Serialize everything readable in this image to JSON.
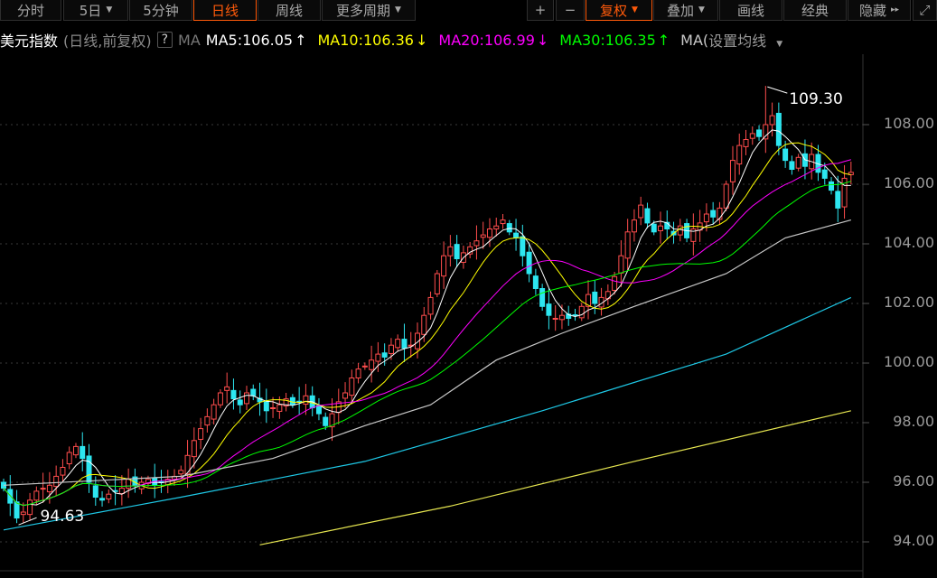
{
  "toolbar": {
    "left": [
      {
        "label": "分时"
      },
      {
        "label": "5日",
        "caret": "▼"
      },
      {
        "label": "5分钟"
      },
      {
        "label": "日线",
        "active": true
      },
      {
        "label": "周线"
      },
      {
        "label": "更多周期",
        "caret": "▼"
      }
    ],
    "right": [
      {
        "label": "+"
      },
      {
        "label": "−"
      },
      {
        "label": "复权",
        "caret": "▼",
        "active": true
      },
      {
        "label": "叠加",
        "caret": "▼"
      },
      {
        "label": "画线"
      },
      {
        "label": "经典"
      },
      {
        "label": "隐藏",
        "caret": "▸▸"
      },
      {
        "label": "⤢"
      }
    ]
  },
  "legend": {
    "title": "美元指数",
    "subtitle": "(日线,前复权)",
    "help": "?",
    "ma": "MA",
    "ma5": "MA5:106.05",
    "ma5_arrow": "↑",
    "ma10": "MA10:106.36",
    "ma10_arrow": "↓",
    "ma20": "MA20:106.99",
    "ma20_arrow": "↓",
    "ma30": "MA30:106.35",
    "ma30_arrow": "↑",
    "ma60": "MA(",
    "settings": "设置均线",
    "settings_caret": "▼"
  },
  "colors": {
    "up": "#ff4d4d",
    "down": "#2de6f0",
    "ma5": "#ffffff",
    "ma10": "#ffff00",
    "ma20": "#ff00ff",
    "ma30": "#00ff00",
    "ma60": "#c8c8c8",
    "ma120": "#1ec8e6",
    "ma250": "#e6e650",
    "active": "#ff5a0a"
  },
  "chart_data": {
    "type": "candlestick",
    "y_ticks": [
      "108.00",
      "106.00",
      "104.00",
      "102.00",
      "100.00",
      "98.00",
      "96.00",
      "94.00"
    ],
    "ylim": [
      93.7,
      109.8
    ],
    "closes": [
      95.8,
      95.3,
      94.8,
      95.0,
      95.4,
      95.7,
      95.8,
      95.9,
      96.2,
      96.5,
      97.0,
      97.2,
      96.8,
      96.0,
      95.5,
      95.4,
      95.6,
      95.7,
      95.8,
      96.1,
      95.9,
      96.0,
      96.1,
      95.9,
      96.0,
      96.1,
      96.2,
      96.4,
      96.9,
      97.4,
      97.8,
      98.2,
      98.6,
      99.0,
      99.2,
      98.8,
      98.6,
      99.0,
      98.9,
      98.7,
      98.4,
      98.5,
      98.6,
      98.8,
      98.6,
      98.7,
      98.9,
      98.5,
      98.3,
      97.9,
      98.3,
      98.7,
      99.0,
      99.5,
      99.8,
      99.9,
      100.1,
      100.3,
      100.2,
      100.6,
      100.8,
      100.5,
      100.6,
      101.0,
      101.6,
      102.2,
      103.0,
      103.6,
      103.9,
      103.5,
      103.7,
      103.9,
      104.1,
      104.3,
      104.5,
      104.6,
      104.8,
      104.4,
      104.2,
      103.6,
      103.0,
      102.5,
      101.9,
      101.6,
      101.5,
      101.6,
      101.5,
      101.6,
      101.9,
      102.3,
      102.0,
      102.2,
      102.4,
      102.9,
      103.6,
      104.4,
      104.8,
      105.3,
      104.7,
      104.4,
      104.6,
      104.5,
      104.3,
      104.6,
      104.2,
      104.5,
      104.7,
      105.0,
      104.9,
      105.2,
      106.0,
      106.8,
      107.3,
      107.5,
      107.7,
      107.6,
      108.0,
      108.3,
      107.3,
      106.8,
      106.5,
      106.9,
      106.6,
      107.0,
      106.4,
      106.2,
      105.8,
      105.2,
      106.2,
      106.4
    ],
    "ma60": [
      [
        0,
        95.9
      ],
      [
        27,
        96.2
      ],
      [
        41,
        96.8
      ],
      [
        55,
        97.9
      ],
      [
        65,
        98.6
      ],
      [
        75,
        100.1
      ],
      [
        85,
        101.0
      ],
      [
        96,
        101.9
      ],
      [
        110,
        103.0
      ],
      [
        119,
        104.2
      ],
      [
        129,
        104.8
      ]
    ],
    "ma120": [
      [
        0,
        94.4
      ],
      [
        27,
        95.5
      ],
      [
        55,
        96.7
      ],
      [
        82,
        98.4
      ],
      [
        110,
        100.3
      ],
      [
        129,
        102.2
      ]
    ],
    "ma250": [
      [
        39,
        93.9
      ],
      [
        68,
        95.2
      ],
      [
        96,
        96.7
      ],
      [
        129,
        98.4
      ]
    ],
    "annotations": {
      "high": "109.30",
      "low": "94.63"
    }
  }
}
